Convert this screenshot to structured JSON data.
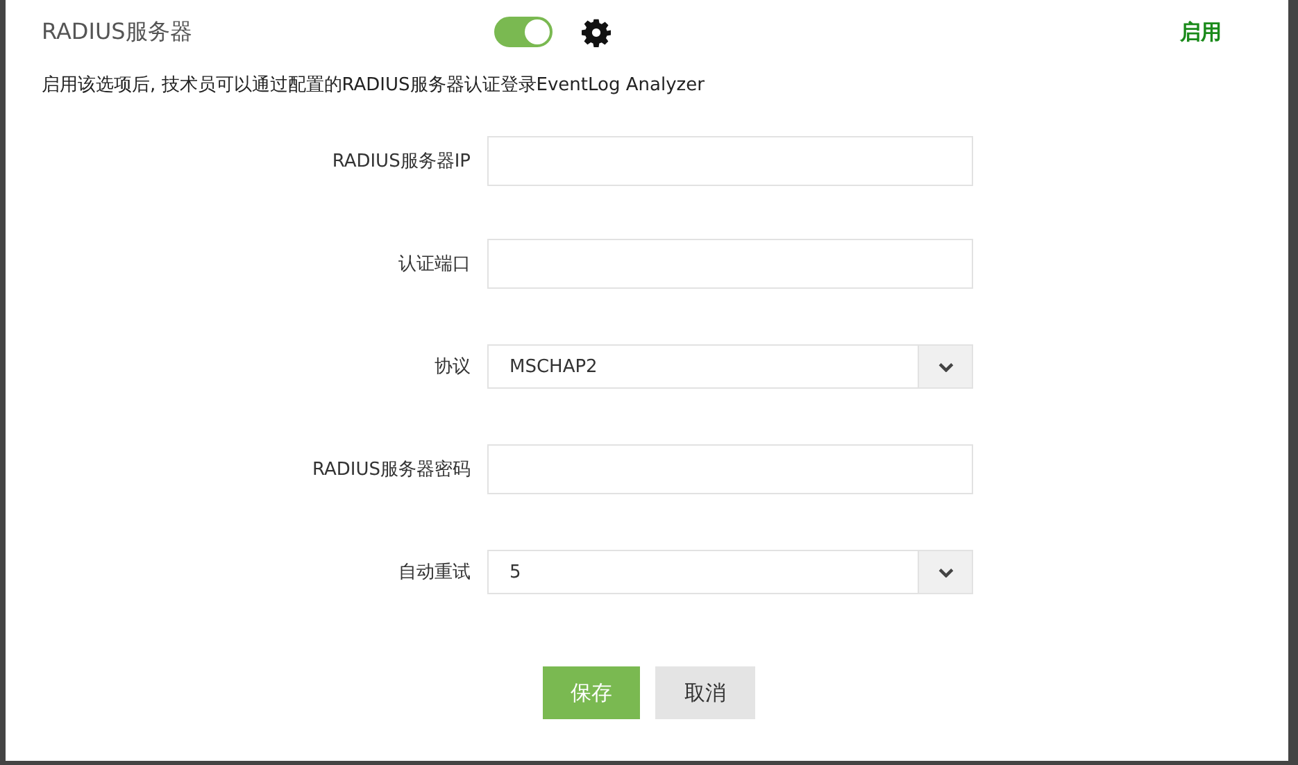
{
  "header": {
    "title": "RADIUS服务器",
    "toggle": {
      "on": true
    },
    "status": "启用"
  },
  "description": "启用该选项后, 技术员可以通过配置的RADIUS服务器认证登录EventLog Analyzer",
  "fields": [
    {
      "label": "RADIUS服务器IP",
      "kind": "text"
    },
    {
      "label": "认证端口",
      "kind": "text"
    },
    {
      "label": "协议",
      "kind": "select",
      "value": "MSCHAP2"
    },
    {
      "label": "RADIUS服务器密码",
      "kind": "text"
    },
    {
      "label": "自动重试",
      "kind": "select",
      "value": "5"
    }
  ],
  "buttons": [
    {
      "label": "保存",
      "kind": "primary"
    },
    {
      "label": "取消",
      "kind": "secondary"
    }
  ]
}
